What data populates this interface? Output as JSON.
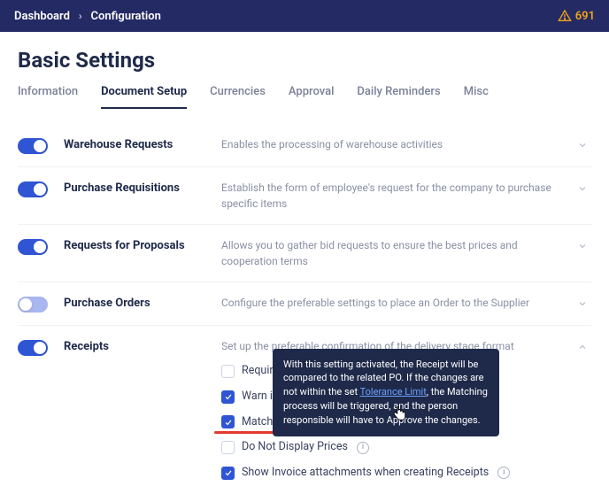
{
  "topbar": {
    "breadcrumb1": "Dashboard",
    "breadcrumb2": "Configuration",
    "alert_count": "691"
  },
  "page_title": "Basic Settings",
  "tabs": {
    "information": "Information",
    "document_setup": "Document Setup",
    "currencies": "Currencies",
    "approval": "Approval",
    "daily_reminders": "Daily Reminders",
    "misc": "Misc"
  },
  "rows": {
    "warehouse": {
      "label": "Warehouse Requests",
      "desc": "Enables the processing of warehouse activities"
    },
    "pr": {
      "label": "Purchase Requisitions",
      "desc": "Establish the form of employee's request for the company to purchase specific items"
    },
    "rfp": {
      "label": "Requests for Proposals",
      "desc": "Allows you to gather bid requests to ensure the best prices and cooperation terms"
    },
    "po": {
      "label": "Purchase Orders",
      "desc": "Configure the preferable settings to place an Order to the Supplier"
    },
    "receipts": {
      "label": "Receipts",
      "desc": "Set up the preferable confirmation of the delivery stage format",
      "opts": {
        "required": "Required R",
        "warn": "Warn if Su",
        "match": "Match with Purchase Order",
        "no_prices": "Do Not Display Prices",
        "show_invoice": "Show Invoice attachments when creating Receipts"
      },
      "tooltip": {
        "t1": "With this setting activated, the Receipt will be compared to the related PO. If the changes are not within the set ",
        "link": "Tolerance Limit",
        "t2": ", the Matching process will be triggered, and the person responsible will have to Approve the changes."
      }
    }
  }
}
